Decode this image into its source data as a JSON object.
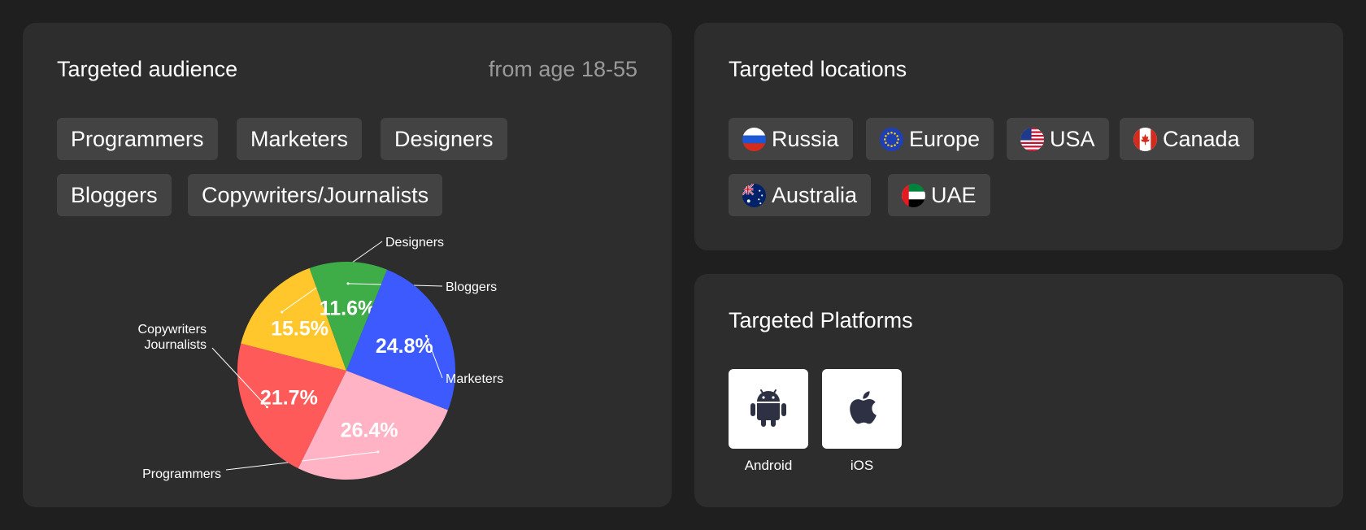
{
  "audience": {
    "title": "Targeted audience",
    "age_range": "from age 18-55",
    "chips": [
      "Programmers",
      "Marketers",
      "Designers",
      "Bloggers",
      "Copywriters/Journalists"
    ]
  },
  "locations": {
    "title": "Targeted locations",
    "chips": [
      {
        "label": "Russia",
        "icon": "russia-flag-icon"
      },
      {
        "label": "Europe",
        "icon": "eu-flag-icon"
      },
      {
        "label": "USA",
        "icon": "usa-flag-icon"
      },
      {
        "label": "Canada",
        "icon": "canada-flag-icon"
      },
      {
        "label": "Australia",
        "icon": "australia-flag-icon"
      },
      {
        "label": "UAE",
        "icon": "uae-flag-icon"
      }
    ]
  },
  "platforms": {
    "title": "Targeted Platforms",
    "items": [
      {
        "label": "Android",
        "icon": "android-icon"
      },
      {
        "label": "iOS",
        "icon": "apple-icon"
      }
    ]
  },
  "chart_data": {
    "type": "pie",
    "slices": [
      {
        "label": "Designers",
        "value": 15.5,
        "display": "15.5%",
        "color": "#ffc72c"
      },
      {
        "label": "Bloggers",
        "value": 11.6,
        "display": "11.6%",
        "color": "#3ead47"
      },
      {
        "label": "Marketers",
        "value": 24.8,
        "display": "24.8%",
        "color": "#3d5afe"
      },
      {
        "label": "Programmers",
        "value": 26.4,
        "display": "26.4%",
        "color": "#ffb3c5"
      },
      {
        "label": "Copywriters\nJournalists",
        "value": 21.7,
        "display": "21.7%",
        "color": "#ff5a5a"
      }
    ]
  }
}
